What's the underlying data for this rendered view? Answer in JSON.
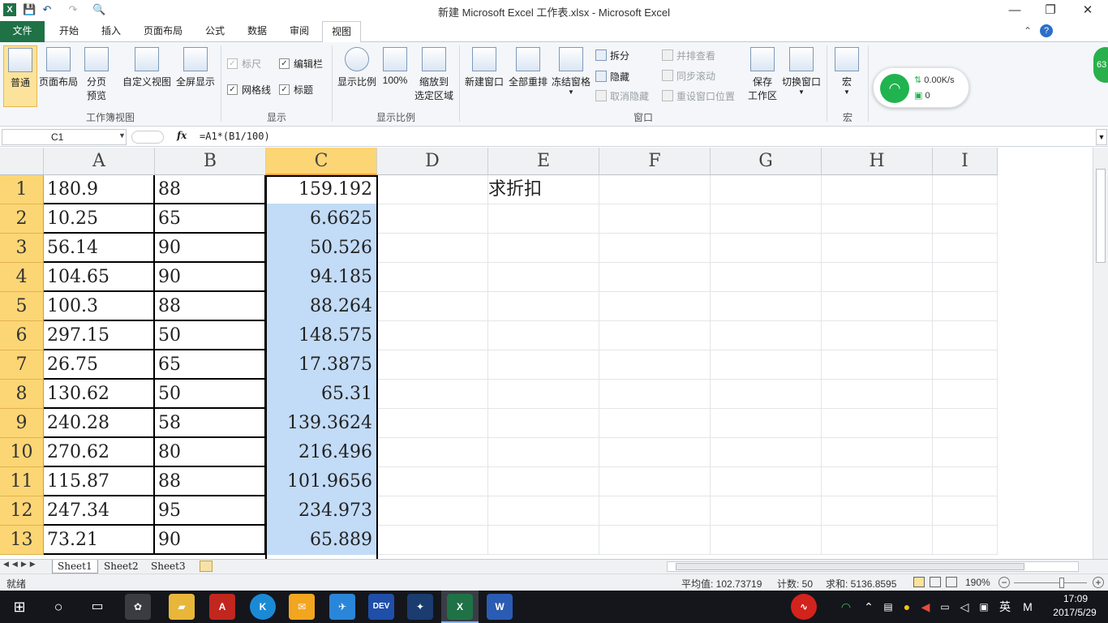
{
  "window": {
    "title": "新建 Microsoft Excel 工作表.xlsx - Microsoft Excel",
    "minimize": "—",
    "restore": "❐",
    "close": "✕"
  },
  "quick_access": {
    "app": "X",
    "save": "💾",
    "undo": "↶",
    "redo": "↷",
    "print": "🔍"
  },
  "tabs": [
    "文件",
    "开始",
    "插入",
    "页面布局",
    "公式",
    "数据",
    "审阅",
    "视图"
  ],
  "ribbon": {
    "workbook_views": {
      "label": "工作簿视图",
      "normal": "普通",
      "page_layout": "页面布局",
      "page_break_1": "分页",
      "page_break_2": "预览",
      "custom": "自定义视图",
      "fullscreen": "全屏显示"
    },
    "show": {
      "label": "显示",
      "ruler": "标尺",
      "edit_bar": "编辑栏",
      "gridlines": "网格线",
      "headings": "标题"
    },
    "zoom": {
      "label": "显示比例",
      "zoom": "显示比例",
      "hundred": "100%",
      "zoom_sel_1": "缩放到",
      "zoom_sel_2": "选定区域"
    },
    "window": {
      "label": "窗口",
      "new_window": "新建窗口",
      "arrange_all": "全部重排",
      "freeze": "冻结窗格",
      "split": "拆分",
      "hide": "隐藏",
      "unhide": "取消隐藏",
      "side_by_side": "并排查看",
      "sync_scroll": "同步滚动",
      "reset_pos": "重设窗口位置",
      "save_ws_1": "保存",
      "save_ws_2": "工作区",
      "switch": "切换窗口"
    },
    "macros": {
      "label": "宏",
      "macros": "宏"
    },
    "network": {
      "speed": "0.00K/s",
      "count": "0",
      "badge": "63"
    }
  },
  "formula_bar": {
    "name_box": "C1",
    "fx": "fx",
    "formula": "=A1*(B1/100)"
  },
  "columns": [
    "A",
    "B",
    "C",
    "D",
    "E",
    "F",
    "G",
    "H",
    "I"
  ],
  "rows": [
    {
      "n": "1",
      "a": "180.9",
      "b": "88",
      "c": "159.192",
      "e": "求折扣"
    },
    {
      "n": "2",
      "a": "10.25",
      "b": "65",
      "c": "6.6625"
    },
    {
      "n": "3",
      "a": "56.14",
      "b": "90",
      "c": "50.526"
    },
    {
      "n": "4",
      "a": "104.65",
      "b": "90",
      "c": "94.185"
    },
    {
      "n": "5",
      "a": "100.3",
      "b": "88",
      "c": "88.264"
    },
    {
      "n": "6",
      "a": "297.15",
      "b": "50",
      "c": "148.575"
    },
    {
      "n": "7",
      "a": "26.75",
      "b": "65",
      "c": "17.3875"
    },
    {
      "n": "8",
      "a": "130.62",
      "b": "50",
      "c": "65.31"
    },
    {
      "n": "9",
      "a": "240.28",
      "b": "58",
      "c": "139.3624"
    },
    {
      "n": "10",
      "a": "270.62",
      "b": "80",
      "c": "216.496"
    },
    {
      "n": "11",
      "a": "115.87",
      "b": "88",
      "c": "101.9656"
    },
    {
      "n": "12",
      "a": "247.34",
      "b": "95",
      "c": "234.973"
    },
    {
      "n": "13",
      "a": "73.21",
      "b": "90",
      "c": "65.889"
    }
  ],
  "sheets": [
    "Sheet1",
    "Sheet2",
    "Sheet3"
  ],
  "status": {
    "ready": "就绪",
    "average": "平均值: 102.73719",
    "count": "计数: 50",
    "sum": "求和: 5136.8595",
    "zoom": "190%"
  },
  "taskbar": {
    "time": "17:09",
    "date": "2017/5/29",
    "ime": "英",
    "ime2": "M"
  }
}
